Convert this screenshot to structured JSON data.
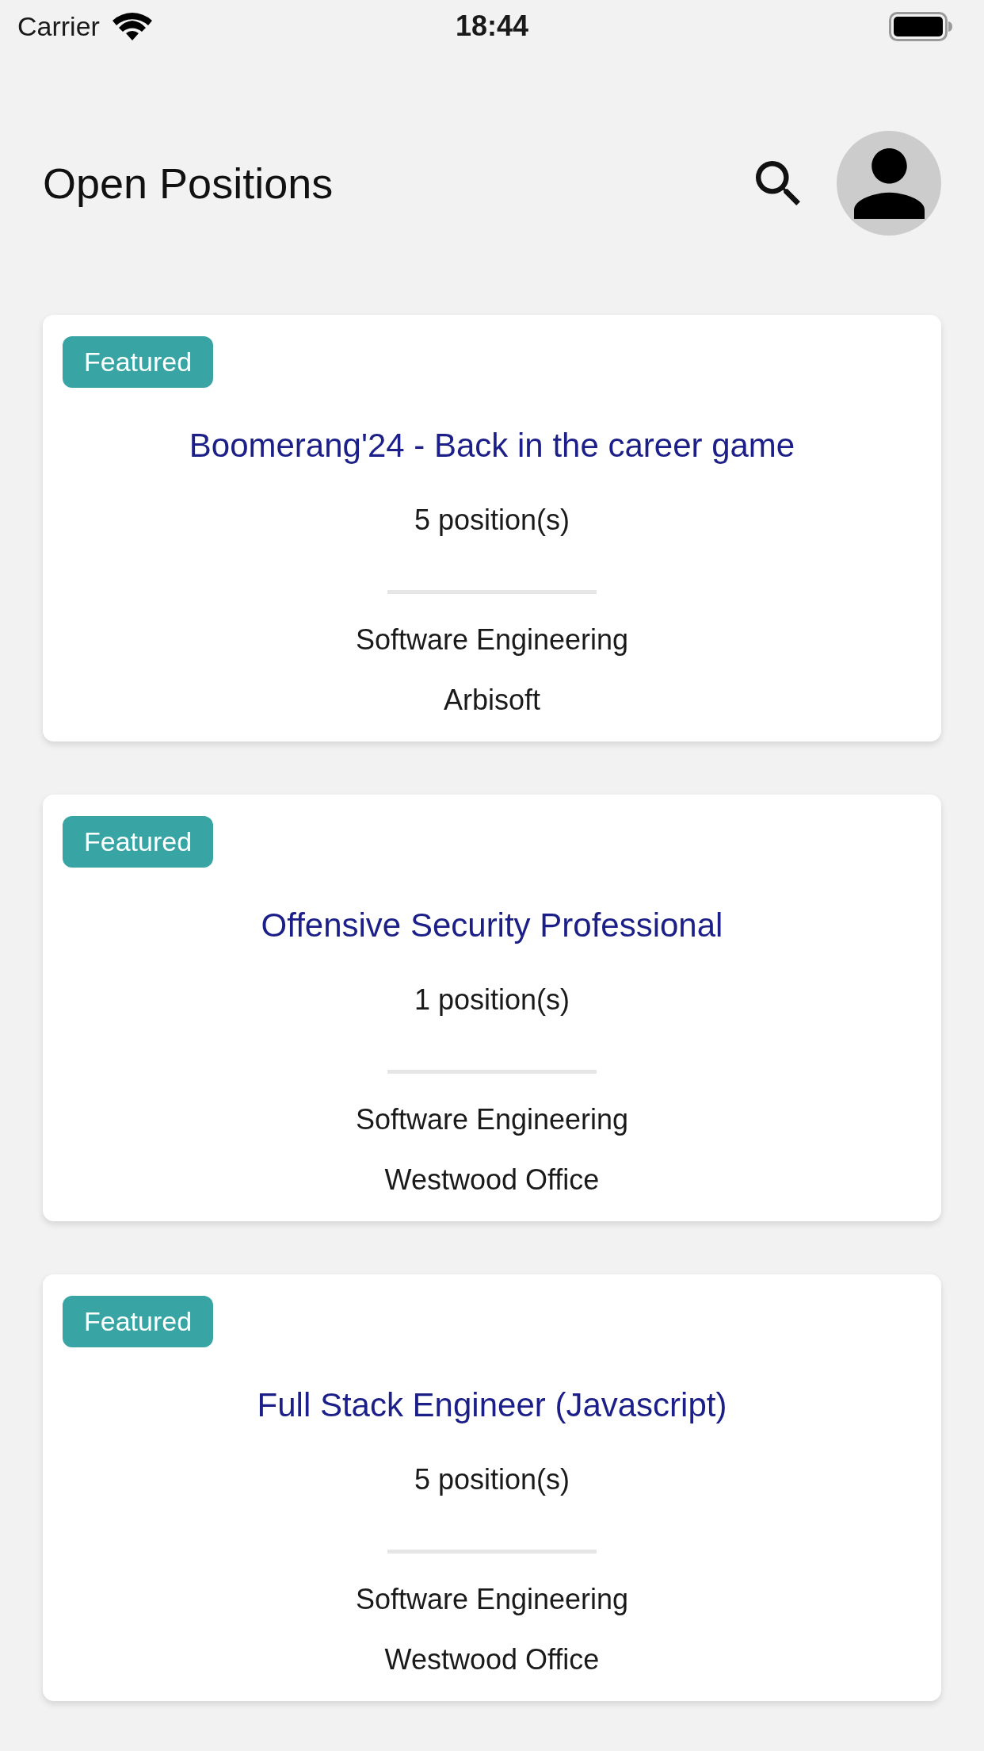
{
  "status_bar": {
    "carrier": "Carrier",
    "time": "18:44"
  },
  "header": {
    "title": "Open Positions"
  },
  "jobs": [
    {
      "badge": "Featured",
      "title": "Boomerang'24 - Back in the career game",
      "positions": "5 position(s)",
      "department": "Software Engineering",
      "location": "Arbisoft"
    },
    {
      "badge": "Featured",
      "title": "Offensive Security Professional",
      "positions": "1 position(s)",
      "department": "Software Engineering",
      "location": "Westwood Office"
    },
    {
      "badge": "Featured",
      "title": "Full Stack Engineer (Javascript)",
      "positions": "5 position(s)",
      "department": "Software Engineering",
      "location": "Westwood Office"
    }
  ]
}
